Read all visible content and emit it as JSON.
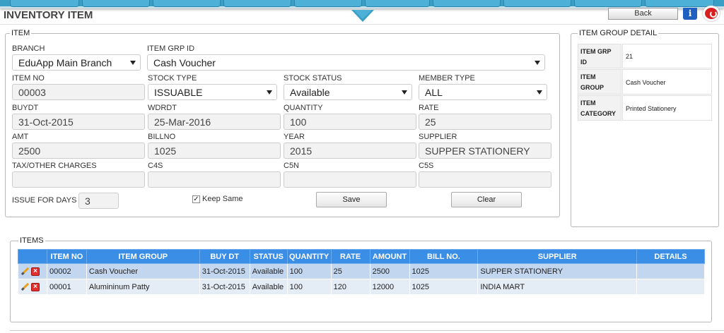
{
  "page": {
    "title": "INVENTORY ITEM",
    "back_label": "Back",
    "info_glyph": "i"
  },
  "item_form": {
    "legend": "ITEM",
    "branch": {
      "label": "BRANCH",
      "value": "EduApp Main Branch"
    },
    "item_grp_id": {
      "label": "ITEM GRP ID",
      "value": "Cash Voucher"
    },
    "item_no": {
      "label": "ITEM NO",
      "value": "00003"
    },
    "stock_type": {
      "label": "STOCK TYPE",
      "value": "ISSUABLE"
    },
    "stock_status": {
      "label": "STOCK STATUS",
      "value": "Available"
    },
    "member_type": {
      "label": "MEMBER TYPE",
      "value": "ALL"
    },
    "buydt": {
      "label": "BUYDT",
      "value": "31-Oct-2015"
    },
    "wdrdt": {
      "label": "WDRDT",
      "value": "25-Mar-2016"
    },
    "quantity": {
      "label": "QUANTITY",
      "value": "100"
    },
    "rate": {
      "label": "RATE",
      "value": "25"
    },
    "amt": {
      "label": "AMT",
      "value": "2500"
    },
    "billno": {
      "label": "BILLNO",
      "value": "1025"
    },
    "year": {
      "label": "YEAR",
      "value": "2015"
    },
    "supplier": {
      "label": "SUPPLIER",
      "value": "SUPPER STATIONERY"
    },
    "tax": {
      "label": "TAX/OTHER CHARGES",
      "value": ""
    },
    "c4s": {
      "label": "C4S",
      "value": ""
    },
    "c5n": {
      "label": "C5N",
      "value": ""
    },
    "c5s": {
      "label": "C5S",
      "value": ""
    },
    "issue_days": {
      "label": "ISSUE FOR DAYS",
      "value": "3"
    },
    "keep_same": {
      "label": "Keep Same",
      "checked": true
    },
    "save_label": "Save",
    "clear_label": "Clear"
  },
  "group_detail": {
    "legend": "ITEM GROUP DETAIL",
    "rows": [
      {
        "key": "ITEM GRP ID",
        "value": "21"
      },
      {
        "key": "ITEM GROUP",
        "value": "Cash Voucher"
      },
      {
        "key": "ITEM CATEGORY",
        "value": "Printed Stationery"
      }
    ]
  },
  "items": {
    "legend": "ITEMS",
    "columns": [
      "",
      "ITEM NO",
      "ITEM GROUP",
      "BUY DT",
      "STATUS",
      "QUANTITY",
      "RATE",
      "AMOUNT",
      "BILL NO.",
      "SUPPLIER",
      "DETAILS"
    ],
    "rows": [
      {
        "item_no": "00002",
        "group": "Cash Voucher",
        "buy_dt": "31-Oct-2015",
        "status": "Available",
        "quantity": "100",
        "rate": "25",
        "amount": "2500",
        "bill_no": "1025",
        "supplier": "SUPPER STATIONERY",
        "details": ""
      },
      {
        "item_no": "00001",
        "group": "Alumininum Patty",
        "buy_dt": "31-Oct-2015",
        "status": "Available",
        "quantity": "100",
        "rate": "120",
        "amount": "12000",
        "bill_no": "1025",
        "supplier": "INDIA MART",
        "details": ""
      }
    ]
  },
  "colors": {
    "nav": "#3a9fc4",
    "table_header": "#3a8ee6",
    "row_selected": "#c2d6ef",
    "row_alt": "#e4ecf6"
  }
}
